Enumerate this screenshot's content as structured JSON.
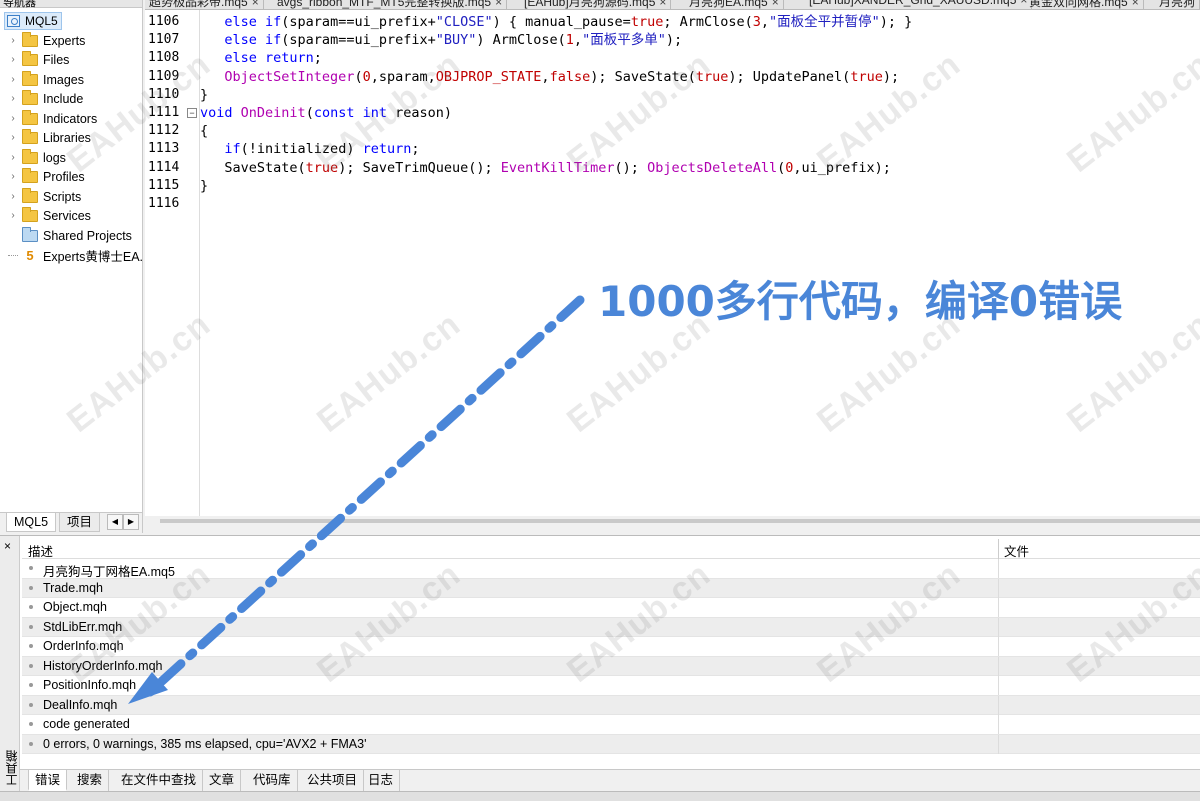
{
  "navigator": {
    "title": "导航器",
    "close": "×",
    "root": "MQL5",
    "items": [
      {
        "label": "Experts",
        "type": "folder"
      },
      {
        "label": "Files",
        "type": "folder"
      },
      {
        "label": "Images",
        "type": "folder"
      },
      {
        "label": "Include",
        "type": "folder"
      },
      {
        "label": "Indicators",
        "type": "folder"
      },
      {
        "label": "Libraries",
        "type": "folder"
      },
      {
        "label": "logs",
        "type": "folder"
      },
      {
        "label": "Profiles",
        "type": "folder"
      },
      {
        "label": "Scripts",
        "type": "folder"
      },
      {
        "label": "Services",
        "type": "folder"
      },
      {
        "label": "Shared Projects",
        "type": "shared"
      },
      {
        "label": "Experts黄博士EA.r",
        "type": "file",
        "badge": "5"
      }
    ],
    "tabs": [
      "MQL5",
      "项目"
    ],
    "scroll_left": "◀",
    "scroll_right": "▶"
  },
  "file_tabs": [
    "超势极品彩带.mq5",
    "avgs_ribbon_MTF_MT5完整转换版.mq5",
    "[EAHub]月亮狗源码.mq5",
    "月亮狗EA.mq5",
    "[EAHub]XANDER_Grid_XAUUSD.mq5",
    "黄金双向网格.mq5",
    "月亮狗"
  ],
  "tab_close": "×",
  "editor": {
    "lines": [
      {
        "n": "1106",
        "fold": ""
      },
      {
        "n": "1107",
        "fold": ""
      },
      {
        "n": "1108",
        "fold": ""
      },
      {
        "n": "1109",
        "fold": ""
      },
      {
        "n": "1110",
        "fold": ""
      },
      {
        "n": "1111",
        "fold": "−"
      },
      {
        "n": "1112",
        "fold": ""
      },
      {
        "n": "1113",
        "fold": ""
      },
      {
        "n": "1114",
        "fold": ""
      },
      {
        "n": "1115",
        "fold": ""
      },
      {
        "n": "1116",
        "fold": ""
      }
    ],
    "code": [
      [
        {
          "t": "   "
        },
        {
          "t": "else if",
          "c": "kw"
        },
        {
          "t": "(sparam==ui_prefix+"
        },
        {
          "t": "\"CLOSE\"",
          "c": "str"
        },
        {
          "t": ") { manual_pause="
        },
        {
          "t": "true",
          "c": "const"
        },
        {
          "t": "; ArmClose("
        },
        {
          "t": "3",
          "c": "num"
        },
        {
          "t": ","
        },
        {
          "t": "\"面板全平并暂停\"",
          "c": "str"
        },
        {
          "t": "); }"
        }
      ],
      [
        {
          "t": "   "
        },
        {
          "t": "else if",
          "c": "kw"
        },
        {
          "t": "(sparam==ui_prefix+"
        },
        {
          "t": "\"BUY\"",
          "c": "str"
        },
        {
          "t": ") ArmClose("
        },
        {
          "t": "1",
          "c": "num"
        },
        {
          "t": ","
        },
        {
          "t": "\"面板平多单\"",
          "c": "str"
        },
        {
          "t": ");"
        }
      ],
      [
        {
          "t": "   "
        },
        {
          "t": "else return",
          "c": "kw"
        },
        {
          "t": ";"
        }
      ],
      [
        {
          "t": "   "
        },
        {
          "t": "ObjectSetInteger",
          "c": "fn"
        },
        {
          "t": "("
        },
        {
          "t": "0",
          "c": "num"
        },
        {
          "t": ",sparam,"
        },
        {
          "t": "OBJPROP_STATE",
          "c": "const"
        },
        {
          "t": ","
        },
        {
          "t": "false",
          "c": "const"
        },
        {
          "t": "); SaveState("
        },
        {
          "t": "true",
          "c": "const"
        },
        {
          "t": "); UpdatePanel("
        },
        {
          "t": "true",
          "c": "const"
        },
        {
          "t": ");"
        }
      ],
      [
        {
          "t": "}"
        }
      ],
      [
        {
          "t": "void",
          "c": "kw"
        },
        {
          "t": " "
        },
        {
          "t": "OnDeinit",
          "c": "fn"
        },
        {
          "t": "("
        },
        {
          "t": "const int",
          "c": "kw"
        },
        {
          "t": " reason)"
        }
      ],
      [
        {
          "t": "{"
        }
      ],
      [
        {
          "t": "   "
        },
        {
          "t": "if",
          "c": "kw"
        },
        {
          "t": "(!initialized) "
        },
        {
          "t": "return",
          "c": "kw"
        },
        {
          "t": ";"
        }
      ],
      [
        {
          "t": "   SaveState("
        },
        {
          "t": "true",
          "c": "const"
        },
        {
          "t": "); SaveTrimQueue(); "
        },
        {
          "t": "EventKillTimer",
          "c": "fn"
        },
        {
          "t": "(); "
        },
        {
          "t": "ObjectsDeleteAll",
          "c": "fn"
        },
        {
          "t": "("
        },
        {
          "t": "0",
          "c": "num"
        },
        {
          "t": ",ui_prefix);"
        }
      ],
      [
        {
          "t": "}"
        }
      ],
      []
    ]
  },
  "annotation": {
    "text": "1000多行代码，编译0错误",
    "color": "#4a86d8"
  },
  "watermark": "EAHub.cn",
  "toolbox": {
    "close": "×",
    "side_label": "工具箱",
    "columns": {
      "description": "描述",
      "file": "文件"
    },
    "rows": [
      "月亮狗马丁网格EA.mq5",
      "Trade.mqh",
      "Object.mqh",
      "StdLibErr.mqh",
      "OrderInfo.mqh",
      "HistoryOrderInfo.mqh",
      "PositionInfo.mqh",
      "DealInfo.mqh",
      "code generated",
      "0 errors, 0 warnings, 385 ms elapsed, cpu='AVX2 + FMA3'"
    ],
    "tabs": [
      "错误",
      "搜索",
      "在文件中查找",
      "文章",
      "代码库",
      "公共项目",
      "日志"
    ],
    "active_tab": "错误"
  }
}
